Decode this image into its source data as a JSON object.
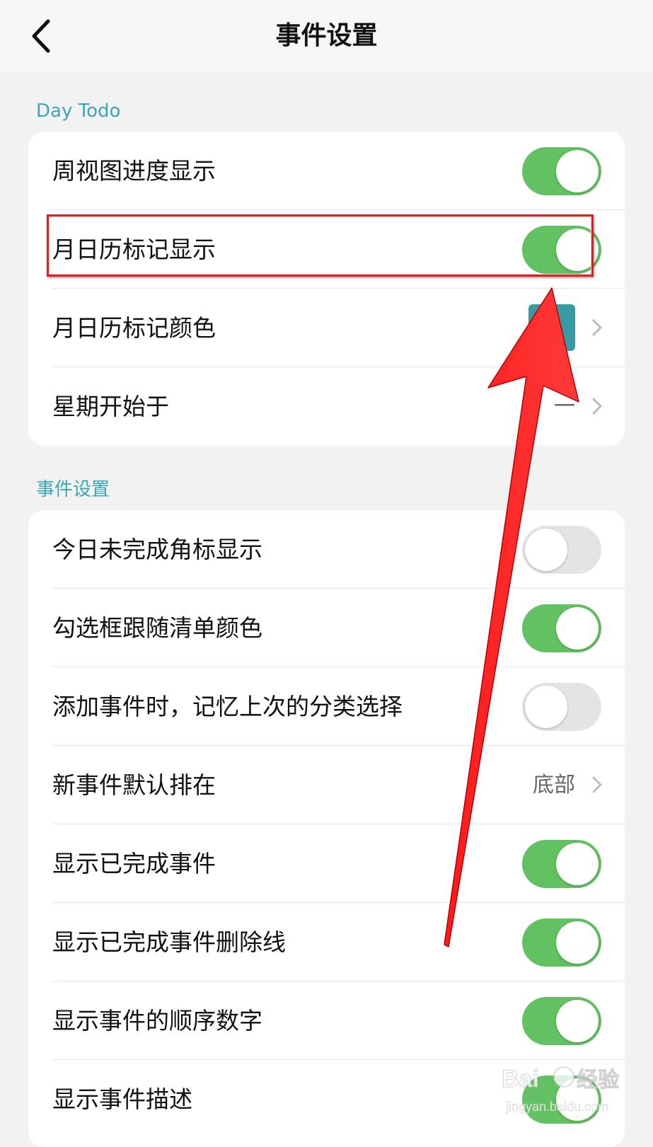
{
  "nav": {
    "title": "事件设置",
    "back_icon": "chevron-left-icon"
  },
  "sections": [
    {
      "title": "Day Todo",
      "rows": [
        {
          "label": "周视图进度显示",
          "type": "toggle",
          "on": true
        },
        {
          "label": "月日历标记显示",
          "type": "toggle",
          "on": true,
          "highlighted": true
        },
        {
          "label": "月日历标记颜色",
          "type": "color",
          "color": "#3a9aa2"
        },
        {
          "label": "星期开始于",
          "type": "value",
          "value": "一"
        }
      ]
    },
    {
      "title": "事件设置",
      "rows": [
        {
          "label": "今日未完成角标显示",
          "type": "toggle",
          "on": false
        },
        {
          "label": "勾选框跟随清单颜色",
          "type": "toggle",
          "on": true
        },
        {
          "label": "添加事件时，记忆上次的分类选择",
          "type": "toggle",
          "on": false
        },
        {
          "label": "新事件默认排在",
          "type": "value",
          "value": "底部"
        },
        {
          "label": "显示已完成事件",
          "type": "toggle",
          "on": true
        },
        {
          "label": "显示已完成事件删除线",
          "type": "toggle",
          "on": true
        },
        {
          "label": "显示事件的顺序数字",
          "type": "toggle",
          "on": true
        },
        {
          "label": "显示事件描述",
          "type": "toggle",
          "on": true
        }
      ]
    }
  ],
  "colors": {
    "toggle_on": "#62c162",
    "toggle_off": "#e4e4e4",
    "section_title": "#3aa6b8",
    "annotation": "#ff0000"
  },
  "watermark": {
    "brand": "Baidu经验",
    "url": "jingyan.baidu.com"
  }
}
